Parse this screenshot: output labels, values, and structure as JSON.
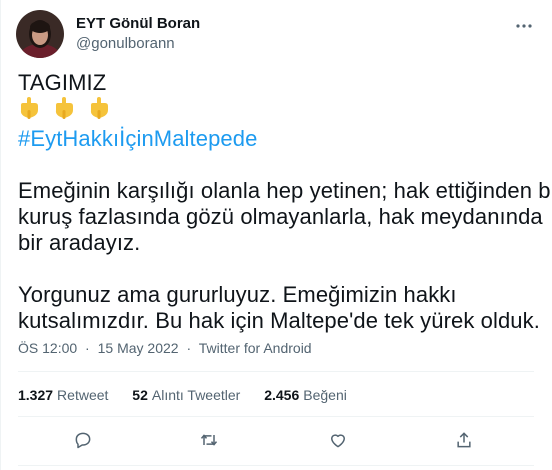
{
  "author": {
    "display_name": "EYT Gönül Boran",
    "handle": "@gonulborann"
  },
  "tweet": {
    "line1": "TAGIMIZ",
    "emojis": [
      "pointing-down-emoji",
      "pointing-down-emoji",
      "pointing-down-emoji"
    ],
    "hashtag": "#EytHakkıİçinMaltepede",
    "para1": [
      "Emeğinin karşılığı olanla hep yetinen; hak ettiğinden bir",
      "kuruş fazlasında gözü olmayanlarla, hak meydanında",
      "bir aradayız."
    ],
    "para2": [
      "Yorgunuz ama gururluyuz. Emeğimizin hakkı",
      "kutsalımızdır. Bu hak için Maltepe'de tek yürek olduk."
    ]
  },
  "meta": {
    "time": "ÖS 12:00",
    "separator": "·",
    "date": "15 May 2022",
    "source": "Twitter for Android"
  },
  "stats": {
    "retweets": {
      "count": "1.327",
      "label": "Retweet"
    },
    "quotes": {
      "count": "52",
      "label": "Alıntı Tweetler"
    },
    "likes": {
      "count": "2.456",
      "label": "Beğeni"
    }
  },
  "icons": {
    "more": "more-icon",
    "reply": "reply-icon",
    "retweet": "retweet-icon",
    "like": "like-icon",
    "share": "share-icon"
  },
  "colors": {
    "text": "#0f1419",
    "secondary": "#536471",
    "link": "#1d9bf0",
    "divider": "#eff3f4"
  }
}
